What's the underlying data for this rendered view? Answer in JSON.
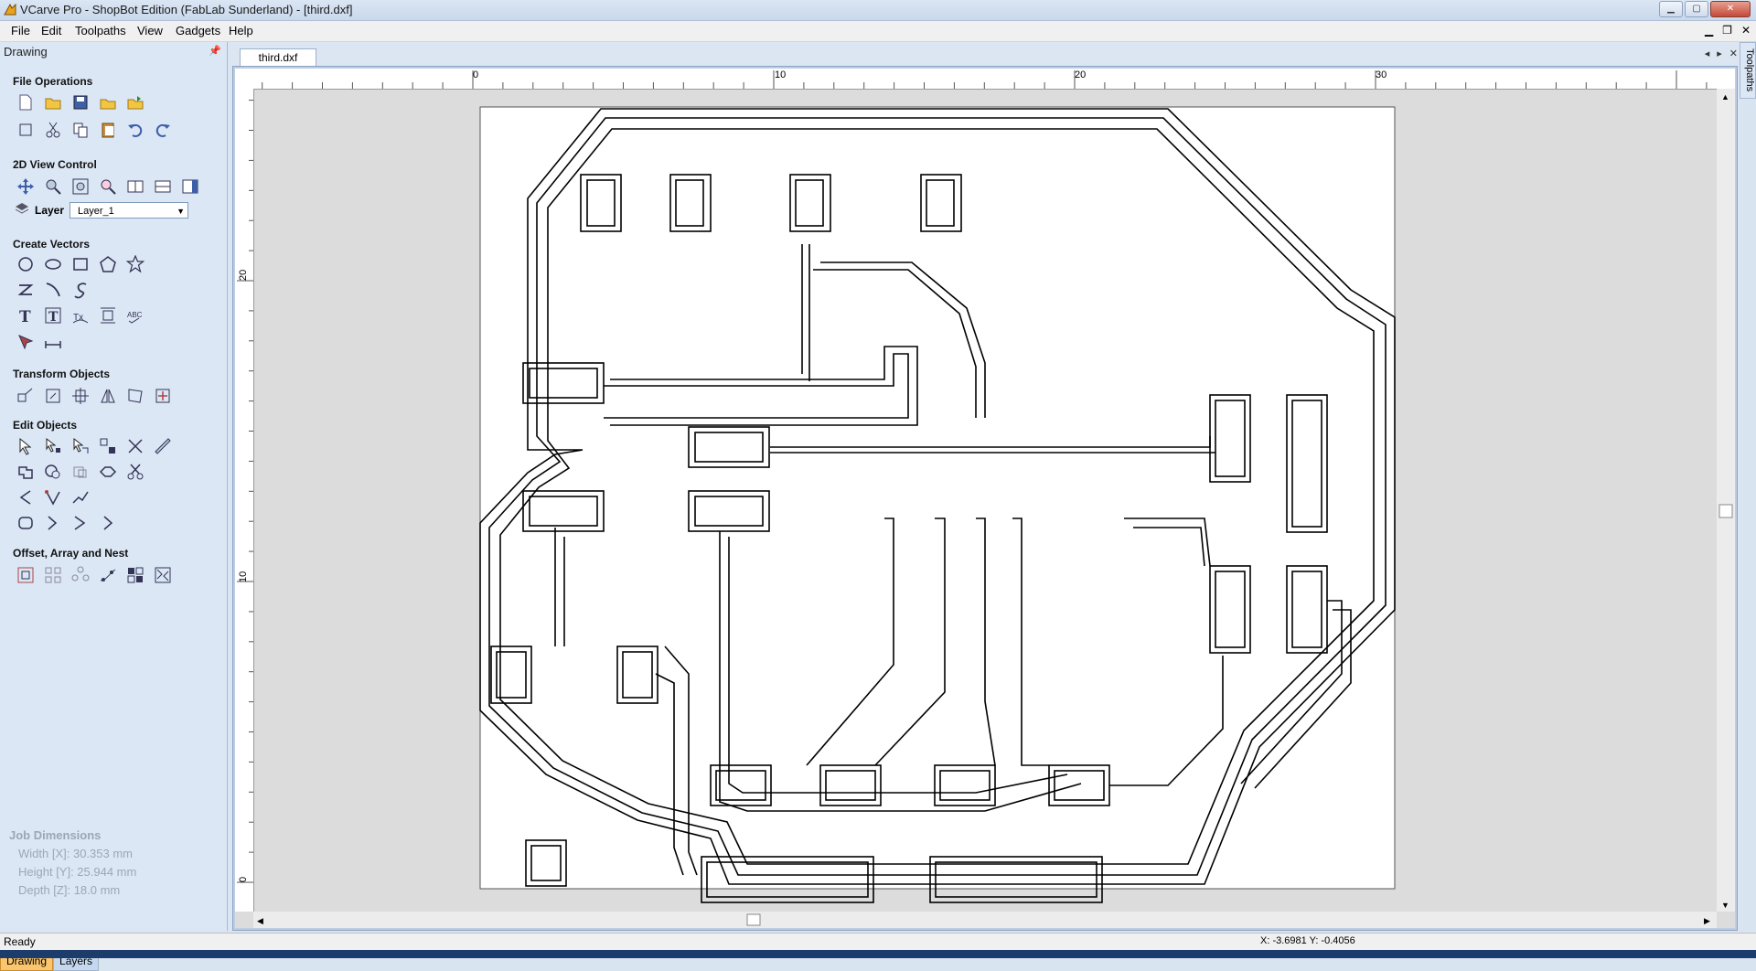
{
  "window": {
    "title": "VCarve Pro - ShopBot Edition (FabLab Sunderland) - [third.dxf]"
  },
  "menu": [
    "File",
    "Edit",
    "Toolpaths",
    "View",
    "Gadgets",
    "Help"
  ],
  "panel": {
    "title": "Drawing",
    "sections": {
      "file_ops": "File Operations",
      "view_control": "2D View Control",
      "create_vectors": "Create Vectors",
      "transform": "Transform Objects",
      "edit_objects": "Edit Objects",
      "offset": "Offset, Array and Nest"
    },
    "layer_label": "Layer",
    "layer_value": "Layer_1",
    "job_dims": {
      "head": "Job Dimensions",
      "width": "Width  [X]: 30.353 mm",
      "height": "Height [Y]: 25.944 mm",
      "depth": "Depth  [Z]: 18.0 mm"
    },
    "tabs": [
      "Drawing",
      "Layers"
    ]
  },
  "document": {
    "tab": "third.dxf"
  },
  "ruler": {
    "top": [
      "0",
      "10",
      "20",
      "30"
    ],
    "left": [
      "20",
      "10",
      "0"
    ]
  },
  "side_strip": "Toolpaths",
  "status": {
    "ready": "Ready",
    "coords": "X: -3.6981 Y: -0.4056"
  }
}
